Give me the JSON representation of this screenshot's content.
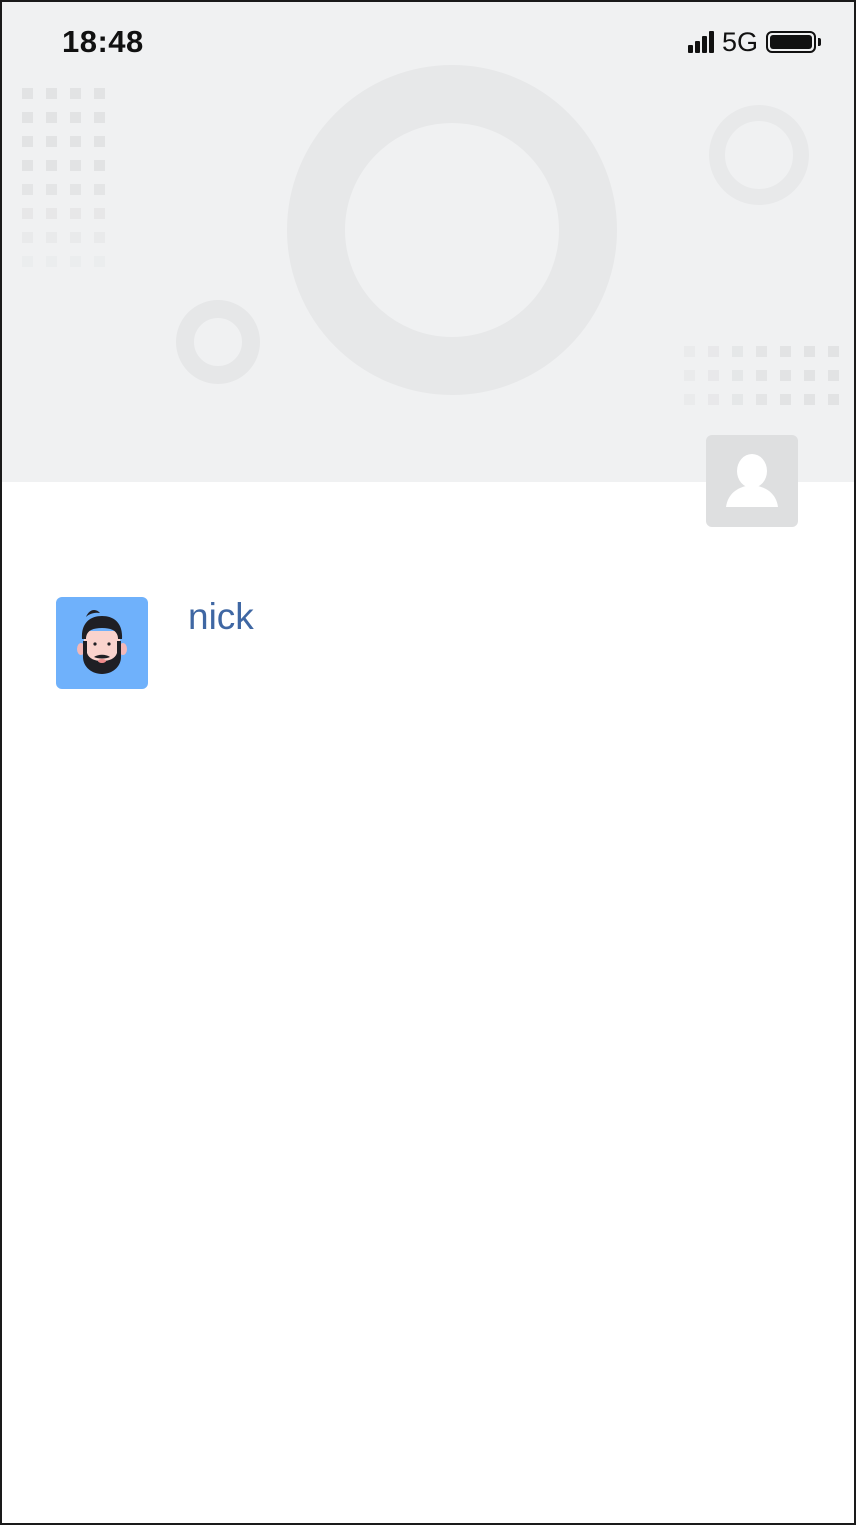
{
  "status_bar": {
    "time": "18:48",
    "network": "5G",
    "signal_icon": "signal-bars-icon",
    "battery_icon": "battery-full-icon",
    "battery_level": 1.0
  },
  "header": {
    "background_color": "#f0f1f2",
    "profile_avatar_icon": "user-silhouette-icon"
  },
  "contacts": [
    {
      "name": "nick",
      "avatar_icon": "bearded-man-avatar-icon",
      "avatar_bg": "#6fb1fb"
    }
  ],
  "colors": {
    "name_text": "#3f67a3",
    "avatar_placeholder": "#dedfe0"
  }
}
